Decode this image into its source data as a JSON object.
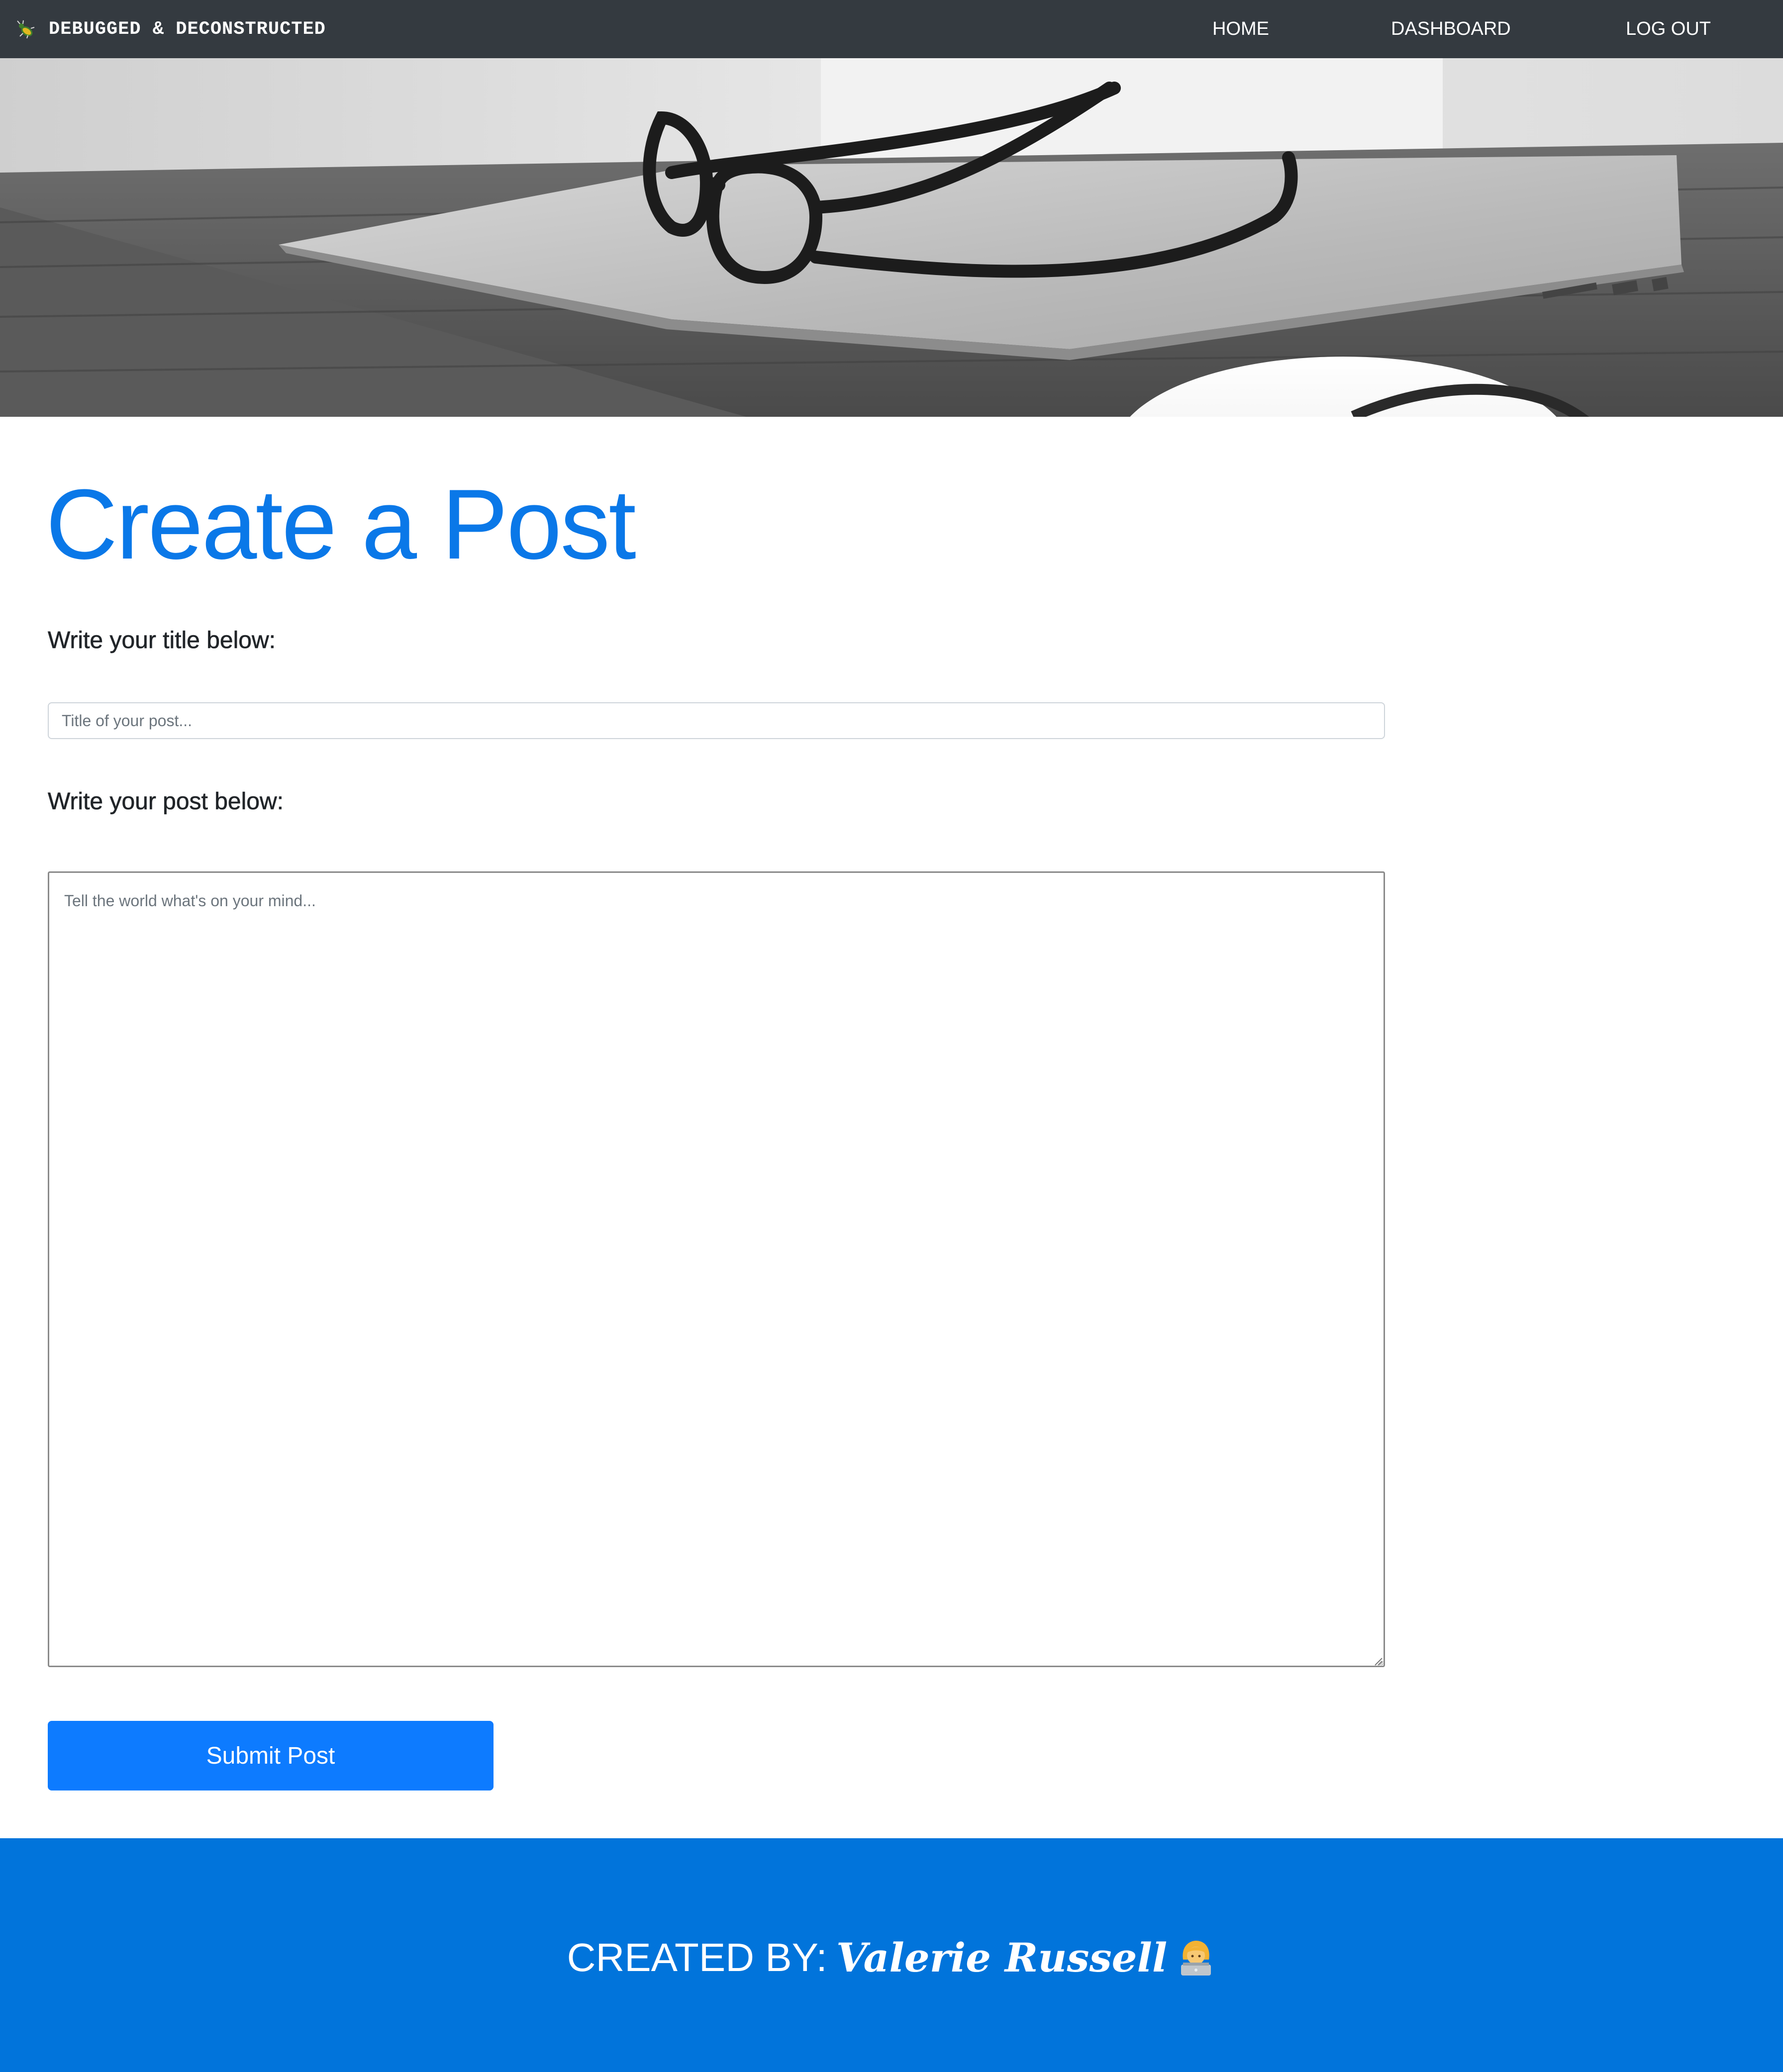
{
  "navbar": {
    "brand": "DEBUGGED & DECONSTRUCTED",
    "brand_icon": "bug-icon",
    "links": [
      "HOME",
      "DASHBOARD",
      "LOG OUT"
    ]
  },
  "hero": {
    "image": "laptop-glasses-mouse-photo"
  },
  "main": {
    "title": "Create a Post",
    "title_label": "Write your title below:",
    "title_placeholder": "Title of your post...",
    "post_label": "Write your post below:",
    "post_placeholder": "Tell the world what's on your mind...",
    "submit_label": "Submit Post"
  },
  "footer": {
    "credit_label": "CREATED BY:",
    "credit_name": "Valerie Russell",
    "credit_icon": "woman-technologist-icon"
  },
  "colors": {
    "navbar": "#343a40",
    "accent": "#0a78e8",
    "button": "#0d7bff",
    "footer": "#0174db"
  }
}
